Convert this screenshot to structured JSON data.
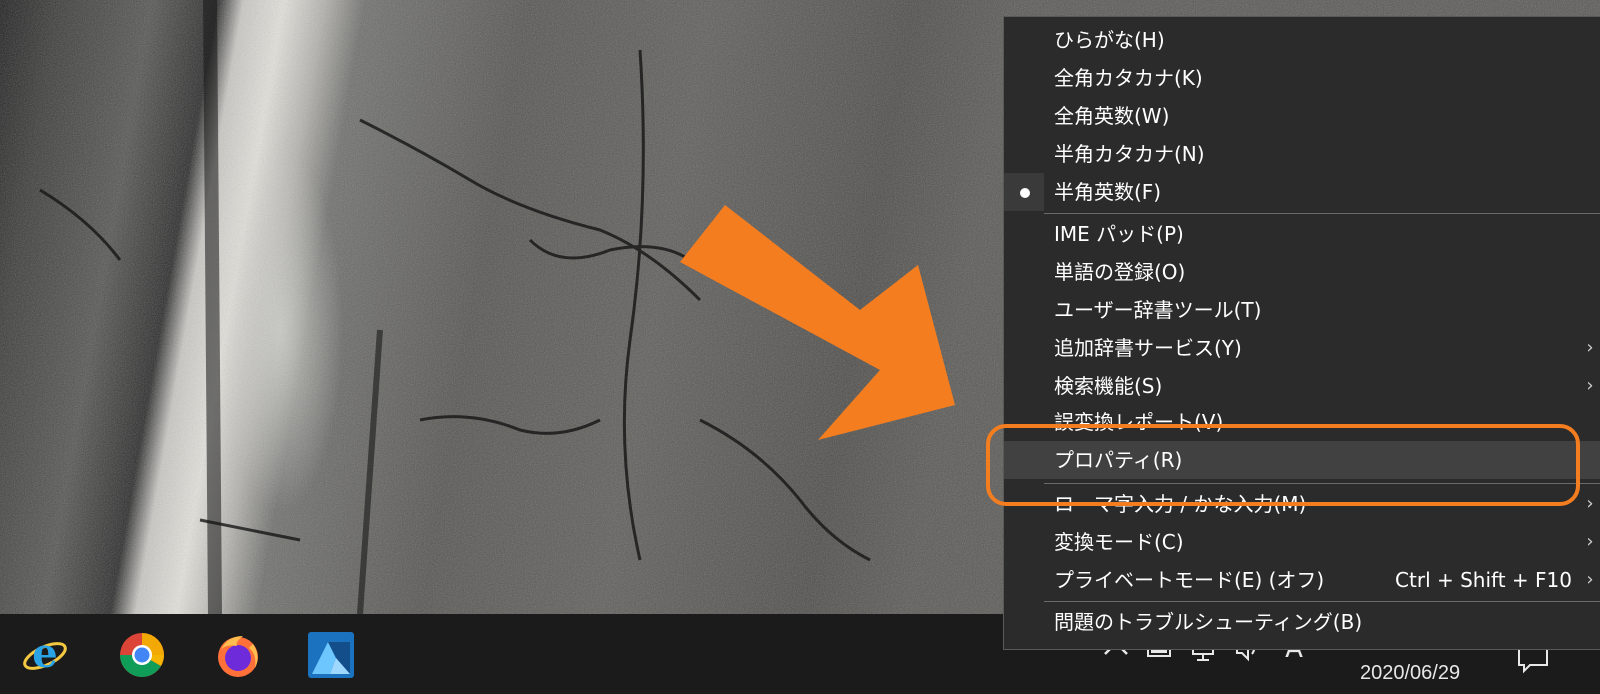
{
  "menu": {
    "items": [
      {
        "label": "ひらがな(H)"
      },
      {
        "label": "全角カタカナ(K)"
      },
      {
        "label": "全角英数(W)"
      },
      {
        "label": "半角カタカナ(N)"
      },
      {
        "label": "半角英数(F)",
        "selected": true
      },
      {
        "label": "IME パッド(P)"
      },
      {
        "label": "単語の登録(O)"
      },
      {
        "label": "ユーザー辞書ツール(T)"
      },
      {
        "label": "追加辞書サービス(Y)",
        "submenu": true
      },
      {
        "label": "検索機能(S)",
        "submenu": true
      },
      {
        "label": "誤変換レポート(V)"
      },
      {
        "label": "プロパティ(R)",
        "highlighted": true
      },
      {
        "label": "ローマ字入力 / かな入力(M)",
        "submenu": true
      },
      {
        "label": "変換モード(C)",
        "submenu": true
      },
      {
        "label": "プライベートモード(E) (オフ)",
        "shortcut": "Ctrl + Shift + F10",
        "submenu": true
      },
      {
        "label": "問題のトラブルシューティング(B)"
      }
    ],
    "chevron": "›"
  },
  "taskbar": {
    "apps": [
      "internet-explorer-icon",
      "chrome-icon",
      "firefox-icon",
      "affinity-designer-icon"
    ],
    "tray": {
      "ime_indicator": "A",
      "date": "2020/06/29"
    }
  },
  "colors": {
    "annotation": "#f47d20",
    "menu_bg": "#2b2b2b",
    "menu_hover": "#414141",
    "taskbar_bg": "#1b1b1b"
  }
}
